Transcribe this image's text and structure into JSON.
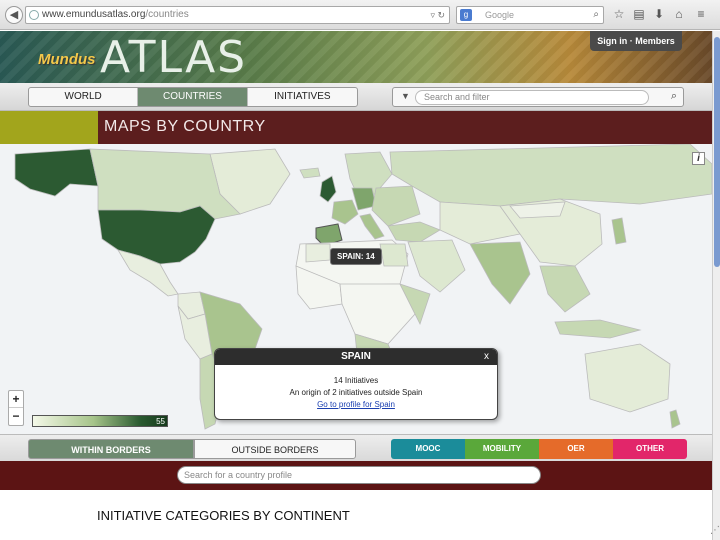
{
  "browser": {
    "url_domain": "www.emundusatlas.org",
    "url_path": "/countries",
    "search_placeholder": "Google"
  },
  "header": {
    "logo_small": "Mundus",
    "logo_big": "ATLAS",
    "signin": "Sign in · Members"
  },
  "nav": {
    "tabs": [
      {
        "label": "WORLD"
      },
      {
        "label": "COUNTRIES"
      },
      {
        "label": "INITIATIVES"
      }
    ],
    "active_tab": "COUNTRIES",
    "filter_placeholder": "Search and filter"
  },
  "section_title": "MAPS BY COUNTRY",
  "map": {
    "hover_label": "SPAIN: 14",
    "legend_max": "55",
    "zoom_in": "+",
    "zoom_out": "−",
    "info": "i"
  },
  "popup": {
    "title": "SPAIN",
    "close": "x",
    "line1": "14 Initiatives",
    "line2": "An origin of 2 initiatives outside Spain",
    "link": "Go to profile for Spain"
  },
  "border_tabs": {
    "within": "WITHIN BORDERS",
    "outside": "OUTSIDE BORDERS"
  },
  "categories": [
    {
      "label": "MOOC",
      "color": "#1b8c9a"
    },
    {
      "label": "MOBILITY",
      "color": "#5aa83a"
    },
    {
      "label": "OER",
      "color": "#e56b2a"
    },
    {
      "label": "OTHER",
      "color": "#e2266a"
    }
  ],
  "country_search_placeholder": "Search for a country profile",
  "caption": "INITIATIVE CATEGORIES BY CONTINENT"
}
